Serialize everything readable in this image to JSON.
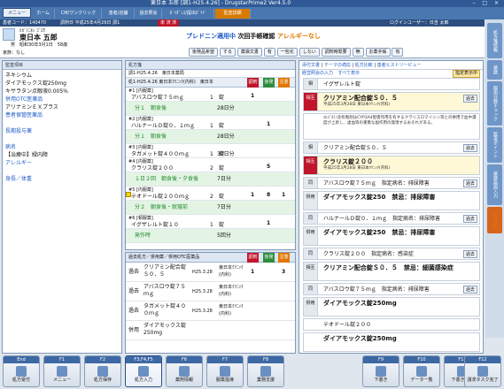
{
  "app": {
    "title": "東日本 五郎 [調1-H25.4.26] - DrugstarPrime2 Ver4.5.0",
    "warn_tab": "監査詳細",
    "window_controls": "– □ ×"
  },
  "tabs": [
    "メニュー",
    "ホーム",
    "CM/ワンクリック",
    "患者/店舗",
    "過去照会",
    "ｶﾞｲﾀﾞﾝｽ/提出ｶﾞｲﾄﾞ"
  ],
  "patient": {
    "label": "患者コード：140470",
    "status_label": "調剤日 平成25年4月26日 調1",
    "badge": "未 済 済",
    "login": "ログインユーザー：日吉 太郎",
    "kana": "ﾋｶﾞｼﾆﾎﾝ ｺﾞﾛｳ",
    "name": "東日本 五郎",
    "dob": "昭和30年3月1日　58歳",
    "gender": "男",
    "alert1": "プレドニン適用中",
    "alert2": "次回手帳確認",
    "alert3": "アレルギーなし",
    "insurance": "家族：なし"
  },
  "toolbar": {
    "tokutei": "後発品希望",
    "tokutei_v": "する",
    "kyokai": "薬袋文書",
    "kyokai_v": "有",
    "ippo": "一包化",
    "ippo_v": "しない",
    "jimu": "調剤時緊要",
    "jimu_v": "無",
    "shosen": "お薬手帳",
    "shosen_v": "有"
  },
  "left": {
    "title": "監査項目",
    "items": [
      "ネキシウム",
      "ダイアモックス錠250mg",
      "キサラタン点眼液0.005%",
      "併用OTC医薬品",
      "アリナミンＥＸプラス",
      "患者保管医薬品"
    ],
    "section2": "長期投与薬",
    "section3": "病名",
    "diag": "【治療中】緑内障",
    "allergy": "アレルギー",
    "section4": "身長／体重"
  },
  "rx": {
    "title": "処方箋",
    "header": "調1-H25.4.26　東日本薬局",
    "sub": "処1-H25.4.26 東日本ｸﾘﾆｯｸ(内科)　東日本",
    "col_a": "調剤",
    "col_b": "後発",
    "col_c": "注意",
    "rows": [
      {
        "no": "#1 [内服薬]",
        "name": "アバスロウ錠７５ｍｇ",
        "qty": "1　錠",
        "days": "",
        "a": "1",
        "b": "",
        "c": ""
      },
      {
        "no": "",
        "name": "分１　朝食後",
        "qty": "",
        "days": "28日分",
        "a": "",
        "b": "",
        "c": ""
      },
      {
        "no": "#2 [内服薬]",
        "name": "ハルナールＤ錠０．１ｍｇ",
        "qty": "1　錠",
        "days": "",
        "a": "",
        "b": "1",
        "c": ""
      },
      {
        "no": "",
        "name": "分１　朝食後",
        "qty": "",
        "days": "28日分",
        "a": "",
        "b": "",
        "c": ""
      },
      {
        "no": "#3 [内服薬]",
        "name": "タガメット錠４００ｍｇ",
        "qty": "1　錠",
        "days": "30日分",
        "a": "",
        "b": "",
        "c": ""
      },
      {
        "no": "#4 [内服薬]",
        "name": "クラリス錠２００",
        "qty": "2　錠",
        "days": "",
        "a": "",
        "b": "5",
        "c": ""
      },
      {
        "no": "",
        "name": "１日２回　朝食後・夕食後",
        "qty": "",
        "days": "7日分",
        "a": "",
        "b": "",
        "c": ""
      },
      {
        "no": "#5 [内服薬]",
        "name": "テオドール錠２００ｍｇ",
        "qty": "2　錠",
        "days": "",
        "a": "1",
        "b": "8",
        "c": "1"
      },
      {
        "no": "",
        "name": "分２　朝食後・就寝前",
        "qty": "",
        "days": "7日分",
        "a": "",
        "b": "",
        "c": ""
      },
      {
        "no": "#6 [頓服薬]",
        "name": "イグザレルト錠１０",
        "qty": "1　錠",
        "days": "",
        "a": "",
        "b": "1",
        "c": ""
      },
      {
        "no": "",
        "name": "発作時",
        "qty": "",
        "days": "5回分",
        "a": "",
        "b": "",
        "c": ""
      }
    ]
  },
  "past": {
    "title": "過去処方／併用薬／併用OTC医薬品",
    "col_a": "調剤",
    "col_b": "後発",
    "col_c": "注意",
    "rows": [
      {
        "tag": "過去",
        "name": "クリアミン配合錠Ｓ０．５",
        "date": "H25.3.28",
        "hosp": "東日本ｸﾘﾆｯｸ(内科)",
        "v": "1",
        "w": "3"
      },
      {
        "tag": "過去",
        "name": "アバスロウ錠７５ｍｇ",
        "date": "H25.3.28",
        "hosp": "東日本ｸﾘﾆｯｸ(内科)",
        "v": "",
        "w": ""
      },
      {
        "tag": "過去",
        "name": "タガメット錠４００ｍｇ",
        "date": "H25.3.28",
        "hosp": "東日本ｸﾘﾆｯｸ(内科)",
        "v": "",
        "w": ""
      },
      {
        "tag": "併用",
        "name": "ダイアモックス錠250mg",
        "date": "",
        "hosp": "",
        "v": "",
        "w": ""
      }
    ]
  },
  "right": {
    "tabs": [
      "添付文書",
      "テーマの適応",
      "処方比較",
      "患者ヒストリービュー"
    ],
    "sub": [
      "経営照会の入力",
      "すべて表示"
    ],
    "badge": "指定表示中",
    "cards": [
      {
        "tag": "相",
        "tagtype": "",
        "top": "イグザレルト錠",
        "main": "",
        "sub": "",
        "badge": ""
      },
      {
        "tag": "相互",
        "tagtype": "rd",
        "top": "",
        "main": "クリアミン配合錠Ｓ０．５",
        "sub": "平成25年3月28日 東日本ｸﾘﾆｯｸ(内科)",
        "badge": "過去"
      },
      {
        "tag": "",
        "tagtype": "",
        "top": "",
        "main": "",
        "sub": "ｴﾙｺﾞﾀﾐﾝ含有製剤はCYP3A4阻害作用を有するクラリスロマイシン等との併用で血中濃度が上昇し、虚血等の重篤な副作用の発現するおそれがある。",
        "badge": ""
      },
      {
        "tag": "相",
        "tagtype": "",
        "top": "クリアミン配合錠Ｓ０．５",
        "main": "",
        "sub": "",
        "badge": "過去"
      },
      {
        "tag": "相互",
        "tagtype": "rd",
        "top": "",
        "main": "クラリス錠２００",
        "sub": "平成25年3月28日 東日本ｸﾘﾆｯｸ(内科)",
        "badge": ""
      },
      {
        "tag": "同",
        "tagtype": "",
        "top": "アバスロウ錠７５ｍｇ　指定病名：排尿障害",
        "main": "",
        "sub": "",
        "badge": "過去"
      },
      {
        "tag": "併用",
        "tagtype": "",
        "top": "",
        "main": "ダイアモックス錠250　禁忌：排尿障害",
        "sub": "",
        "badge": ""
      },
      {
        "tag": "同",
        "tagtype": "",
        "top": "ハルナールＤ錠０．１ｍｇ　指定病名：排尿障害",
        "main": "",
        "sub": "",
        "badge": "過去"
      },
      {
        "tag": "併用",
        "tagtype": "",
        "top": "",
        "main": "ダイアモックス錠250　禁忌：排尿障害",
        "sub": "",
        "badge": ""
      },
      {
        "tag": "同",
        "tagtype": "",
        "top": "クラリス錠２００　指定病名：感染症",
        "main": "",
        "sub": "",
        "badge": "過去"
      },
      {
        "tag": "相互",
        "tagtype": "",
        "top": "",
        "main": "クリアミン配合錠Ｓ０．５　禁忌：細菌感染症",
        "sub": "",
        "badge": ""
      },
      {
        "tag": "同",
        "tagtype": "",
        "top": "アバスロウ錠７５ｍｇ　指定病名：排尿障害",
        "main": "",
        "sub": "",
        "badge": "過去"
      },
      {
        "tag": "併用",
        "tagtype": "",
        "top": "",
        "main": "ダイアモックス錠250mg",
        "sub": "",
        "badge": ""
      },
      {
        "tag": "",
        "tagtype": "",
        "top": "テオドール錠２００",
        "main": "",
        "sub": "",
        "badge": ""
      },
      {
        "tag": "",
        "tagtype": "",
        "top": "",
        "main": "ダイアモックス錠250mg",
        "sub": "",
        "badge": ""
      }
    ]
  },
  "side_tabs": [
    "処方箋情報",
    "薬歴",
    "服用日数チェック",
    "監査ポイント",
    "薬歴画面入力",
    "患者情報"
  ],
  "footer": [
    {
      "fk": "End",
      "label": "処方受付"
    },
    {
      "fk": "F1",
      "label": "メニュー"
    },
    {
      "fk": "F2",
      "label": "処方保存"
    },
    {
      "fk": "F3,F4,F5",
      "label": "処方入力"
    },
    {
      "fk": "F6",
      "label": "薬剤情報"
    },
    {
      "fk": "F7",
      "label": "服薬指導"
    },
    {
      "fk": "F8",
      "label": "業務支援"
    },
    {
      "fk": "F9",
      "label": "下書き"
    },
    {
      "fk": "F10",
      "label": "データ一覧"
    },
    {
      "fk": "F11",
      "label": "下書き保存"
    },
    {
      "fk": "F12",
      "label": "請求タスク完了"
    }
  ],
  "colors": {
    "accent": "#2f5a96",
    "alert_red": "#c0152a",
    "alert_orange": "#e07800",
    "check_green": "#1d8a2d"
  }
}
